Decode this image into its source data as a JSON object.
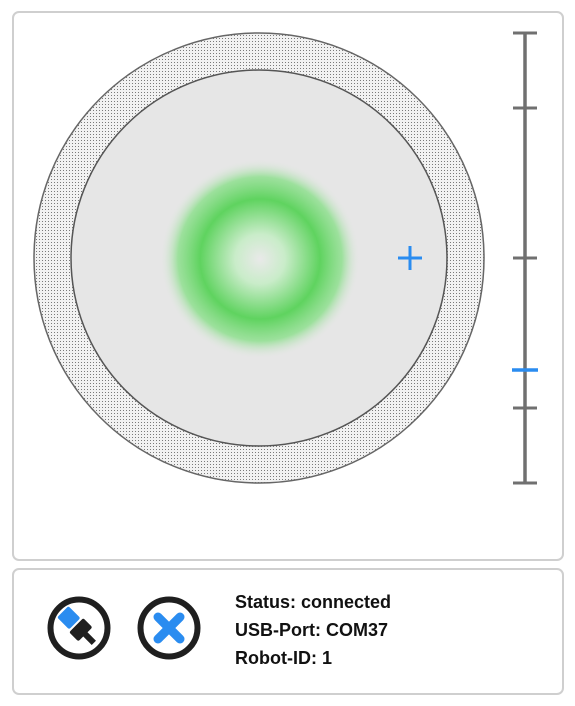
{
  "status": {
    "status_label": "Status:",
    "status_value": "connected",
    "port_label": "USB-Port:",
    "port_value": "COM37",
    "robot_label": "Robot-ID:",
    "robot_value": "1"
  },
  "buttons": {
    "connect_icon": "usb-plug-icon",
    "disconnect_icon": "close-x-icon"
  },
  "colors": {
    "accent": "#2a8cf0",
    "glow": "#3fcf3f",
    "outline": "#666666",
    "ring_fill": "#e6e6e6",
    "button_border": "#1f1f1f"
  }
}
